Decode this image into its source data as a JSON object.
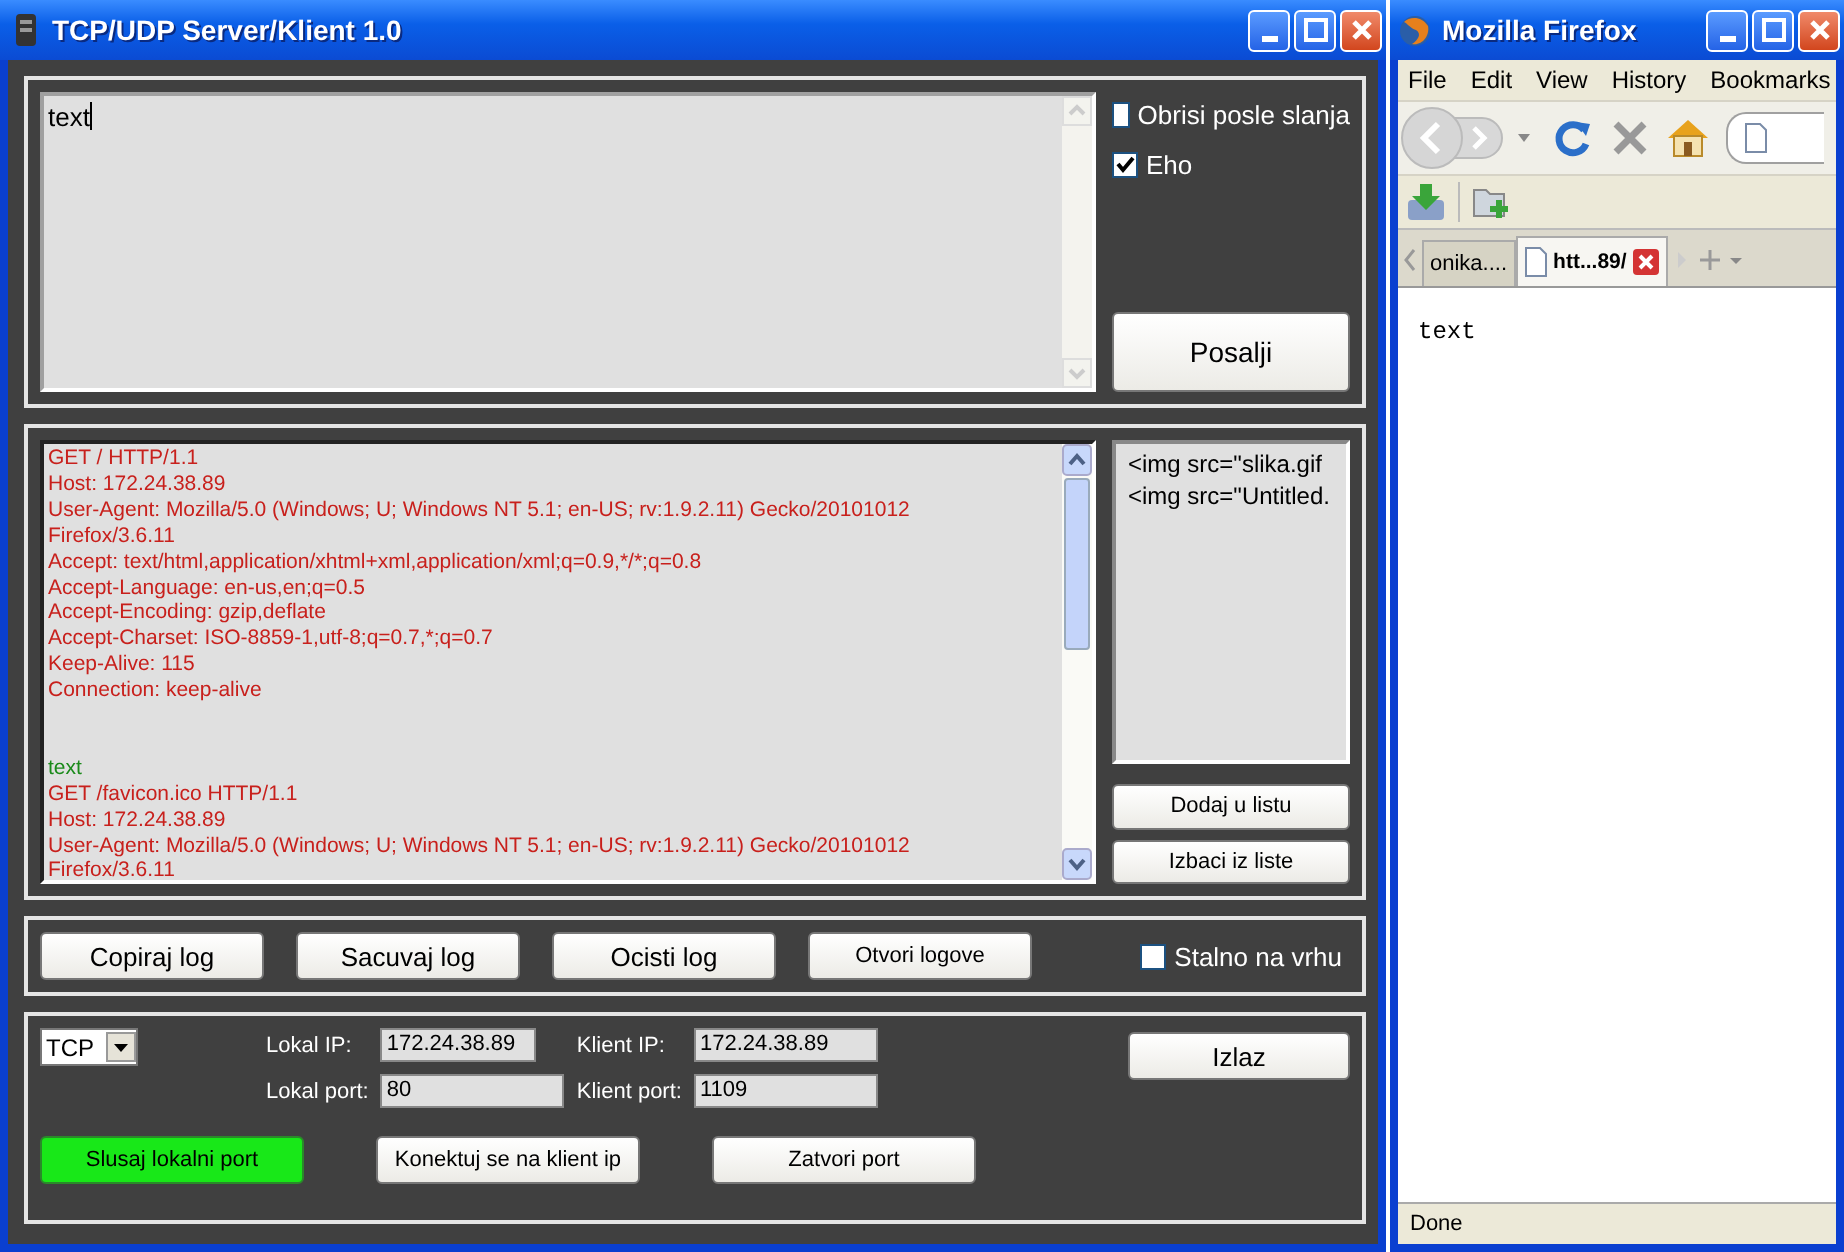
{
  "app_window": {
    "title": "TCP/UDP Server/Klient 1.0"
  },
  "message": {
    "value": "text"
  },
  "options": [
    {
      "label": "Obrisi posle slanja",
      "checked": false
    },
    {
      "label": "Eho",
      "checked": true
    }
  ],
  "send_button": "Posalji",
  "log": [
    {
      "kind": "request",
      "lines": [
        "GET / HTTP/1.1",
        "Host: 172.24.38.89",
        "User-Agent: Mozilla/5.0 (Windows; U; Windows NT 5.1; en-US; rv:1.9.2.11) Gecko/20101012",
        "Firefox/3.6.11",
        "Accept: text/html,application/xhtml+xml,application/xml;q=0.9,*/*;q=0.8",
        "Accept-Language: en-us,en;q=0.5",
        "Accept-Encoding: gzip,deflate",
        "Accept-Charset: ISO-8859-1,utf-8;q=0.7,*;q=0.7",
        "Keep-Alive: 115",
        "Connection: keep-alive"
      ]
    },
    {
      "kind": "echo",
      "lines": [
        "text"
      ]
    },
    {
      "kind": "request",
      "lines": [
        "GET /favicon.ico HTTP/1.1",
        "Host: 172.24.38.89",
        "User-Agent: Mozilla/5.0 (Windows; U; Windows NT 5.1; en-US; rv:1.9.2.11) Gecko/20101012",
        "Firefox/3.6.11"
      ]
    }
  ],
  "list": {
    "items": [
      "<img src=\"slika.gif",
      "<img src=\"Untitled."
    ],
    "buttons": [
      "Dodaj u listu",
      "Izbaci iz liste"
    ]
  },
  "log_buttons": [
    "Copiraj log",
    "Sacuvaj log",
    "Ocisti log",
    "Otvori logove"
  ],
  "always_on_top": {
    "label": "Stalno na vrhu",
    "checked": false
  },
  "connection": {
    "protocol": "TCP",
    "fields": [
      {
        "label": "Lokal IP:",
        "value": "172.24.38.89"
      },
      {
        "label": "Klient IP:",
        "value": "172.24.38.89"
      },
      {
        "label": "Lokal port:",
        "value": "80"
      },
      {
        "label": "Klient port:",
        "value": "1109"
      }
    ],
    "exit_button": "Izlaz",
    "actions": [
      {
        "label": "Slusaj lokalni port",
        "active": true
      },
      {
        "label": "Konektuj se na klient ip",
        "active": false
      },
      {
        "label": "Zatvori port",
        "active": false
      }
    ]
  },
  "browser": {
    "title": "Mozilla Firefox",
    "menu": [
      "File",
      "Edit",
      "View",
      "History",
      "Bookmarks"
    ],
    "tabs": [
      {
        "label": "onika....",
        "selected": false
      },
      {
        "label": "htt...89/",
        "selected": true
      }
    ],
    "page_text": "text",
    "status": "Done"
  }
}
